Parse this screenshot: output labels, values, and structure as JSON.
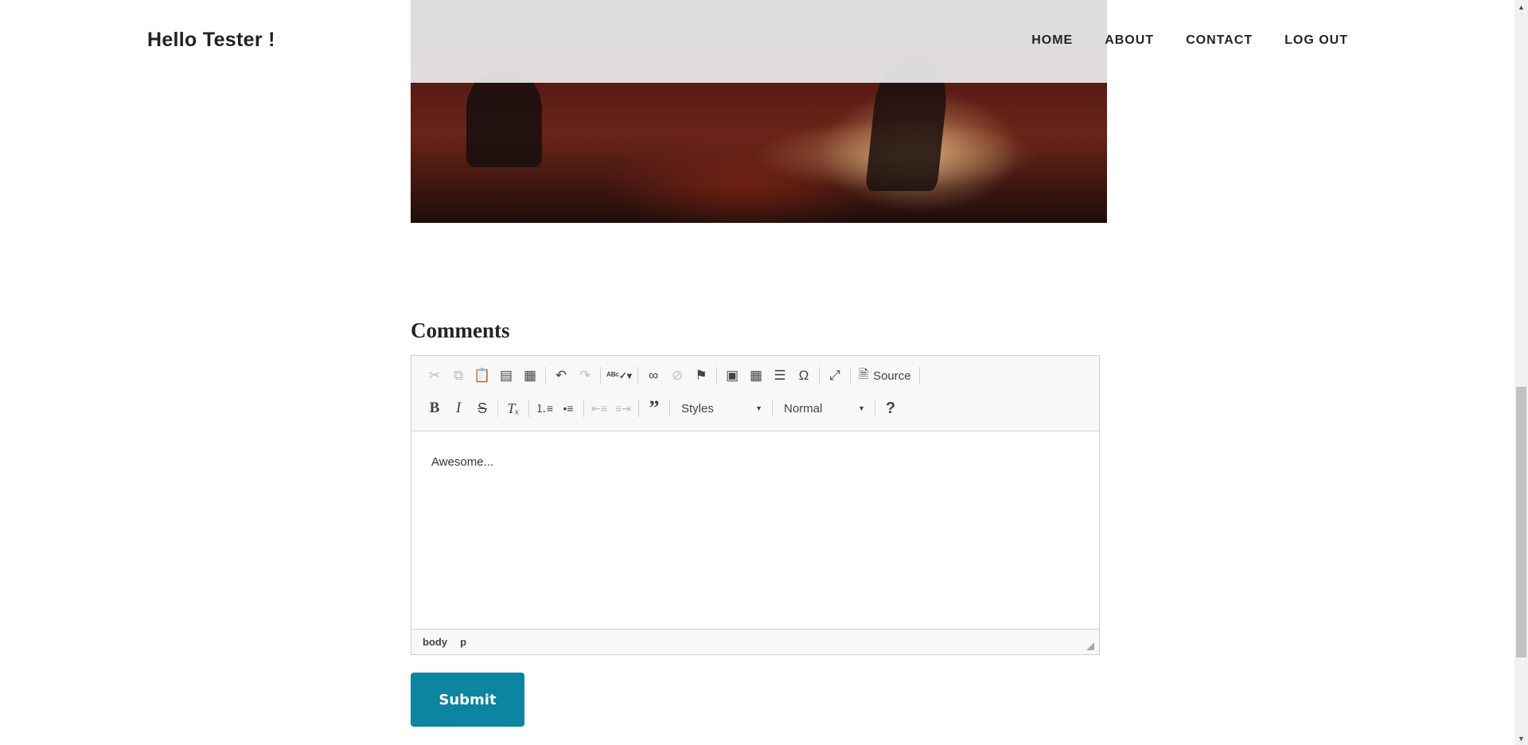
{
  "header": {
    "brand": "Hello Tester !",
    "nav": [
      "HOME",
      "ABOUT",
      "CONTACT",
      "LOG OUT"
    ]
  },
  "comments": {
    "title": "Comments",
    "editor": {
      "source_label": "Source",
      "styles_label": "Styles",
      "format_label": "Normal",
      "help_label": "?",
      "content": "Awesome...",
      "path": [
        "body",
        "p"
      ]
    },
    "submit_label": "Submit"
  },
  "colors": {
    "accent": "#0b85a1"
  }
}
